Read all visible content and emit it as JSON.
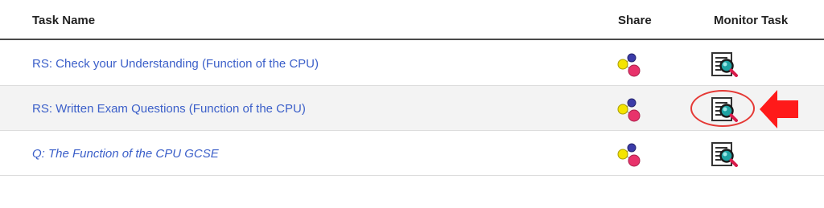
{
  "table": {
    "headers": {
      "task_name": "Task Name",
      "share": "Share",
      "monitor": "Monitor Task"
    },
    "rows": [
      {
        "task_name": "RS: Check your Understanding (Function of the CPU)",
        "style": "normal"
      },
      {
        "task_name": "RS: Written Exam Questions (Function of the CPU)",
        "style": "normal"
      },
      {
        "task_name": "Q: The Function of the CPU GCSE",
        "style": "italic"
      }
    ]
  },
  "icons": {
    "share": "share-icon",
    "monitor": "monitor-task-icon",
    "arrow": "left-arrow-icon"
  },
  "colors": {
    "link": "#3b5fc9",
    "header_border": "#4a4a4a",
    "row_alt_bg": "#f3f3f3",
    "highlight": "#e53935",
    "share_yellow": "#f5e400",
    "share_blue": "#3b3ba8",
    "share_pink": "#e8336b"
  }
}
